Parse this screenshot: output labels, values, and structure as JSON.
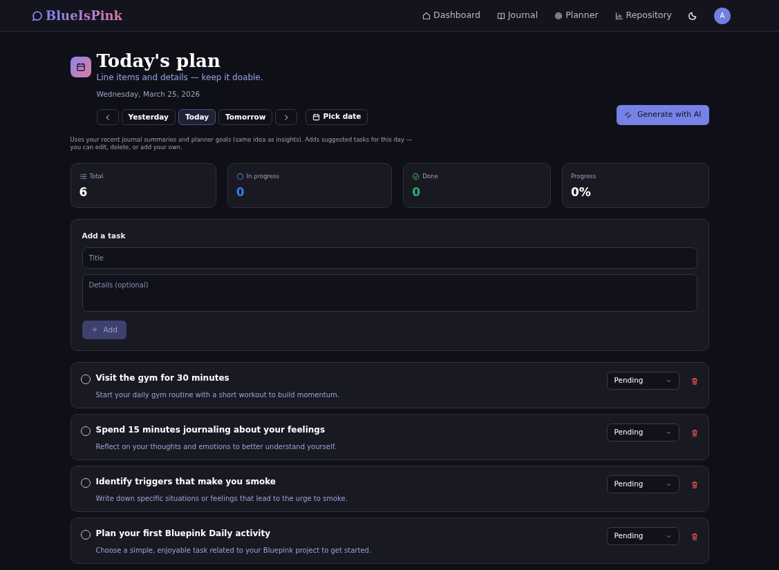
{
  "brand": "BlueIsPink",
  "nav": [
    {
      "label": "Dashboard",
      "kind": "home"
    },
    {
      "label": "Journal",
      "kind": "book"
    },
    {
      "label": "Planner",
      "kind": "target"
    },
    {
      "label": "Repository",
      "kind": "chart"
    }
  ],
  "avatar": "A",
  "header": {
    "title": "Today's plan",
    "subtitle": "Line items and details — keep it doable.",
    "date": "Wednesday, March 25, 2026"
  },
  "day_buttons": [
    {
      "label": "Yesterday",
      "selected": false
    },
    {
      "label": "Today",
      "selected": true
    },
    {
      "label": "Tomorrow",
      "selected": false
    }
  ],
  "pick_date": "Pick date",
  "generate_button": "Generate with AI",
  "note": "Uses your recent journal summaries and planner goals (same idea as insights). Adds suggested tasks for this day — you can edit, delete, or add your own.",
  "stats": [
    {
      "kind": "total",
      "label": "Total",
      "value": "6"
    },
    {
      "kind": "in_progress",
      "label": "In progress",
      "value": "0"
    },
    {
      "kind": "done",
      "label": "Done",
      "value": "0"
    },
    {
      "kind": "progress",
      "label": "Progress",
      "value": "0%"
    }
  ],
  "add_task": {
    "heading": "Add a task",
    "title_placeholder": "Title",
    "details_placeholder": "Details (optional)",
    "button": "Add",
    "disabled": true
  },
  "tasks": [
    {
      "title": "Visit the gym for 30 minutes",
      "details": "Start your daily gym routine with a short workout to build momentum.",
      "status": "Pending",
      "done": false
    },
    {
      "title": "Spend 15 minutes journaling about your feelings",
      "details": "Reflect on your thoughts and emotions to better understand yourself.",
      "status": "Pending",
      "done": false
    },
    {
      "title": "Identify triggers that make you smoke",
      "details": "Write down specific situations or feelings that lead to the urge to smoke.",
      "status": "Pending",
      "done": false
    },
    {
      "title": "Plan your first Bluepink Daily activity",
      "details": "Choose a simple, enjoyable task related to your Bluepink project to get started.",
      "status": "Pending",
      "done": false
    }
  ]
}
